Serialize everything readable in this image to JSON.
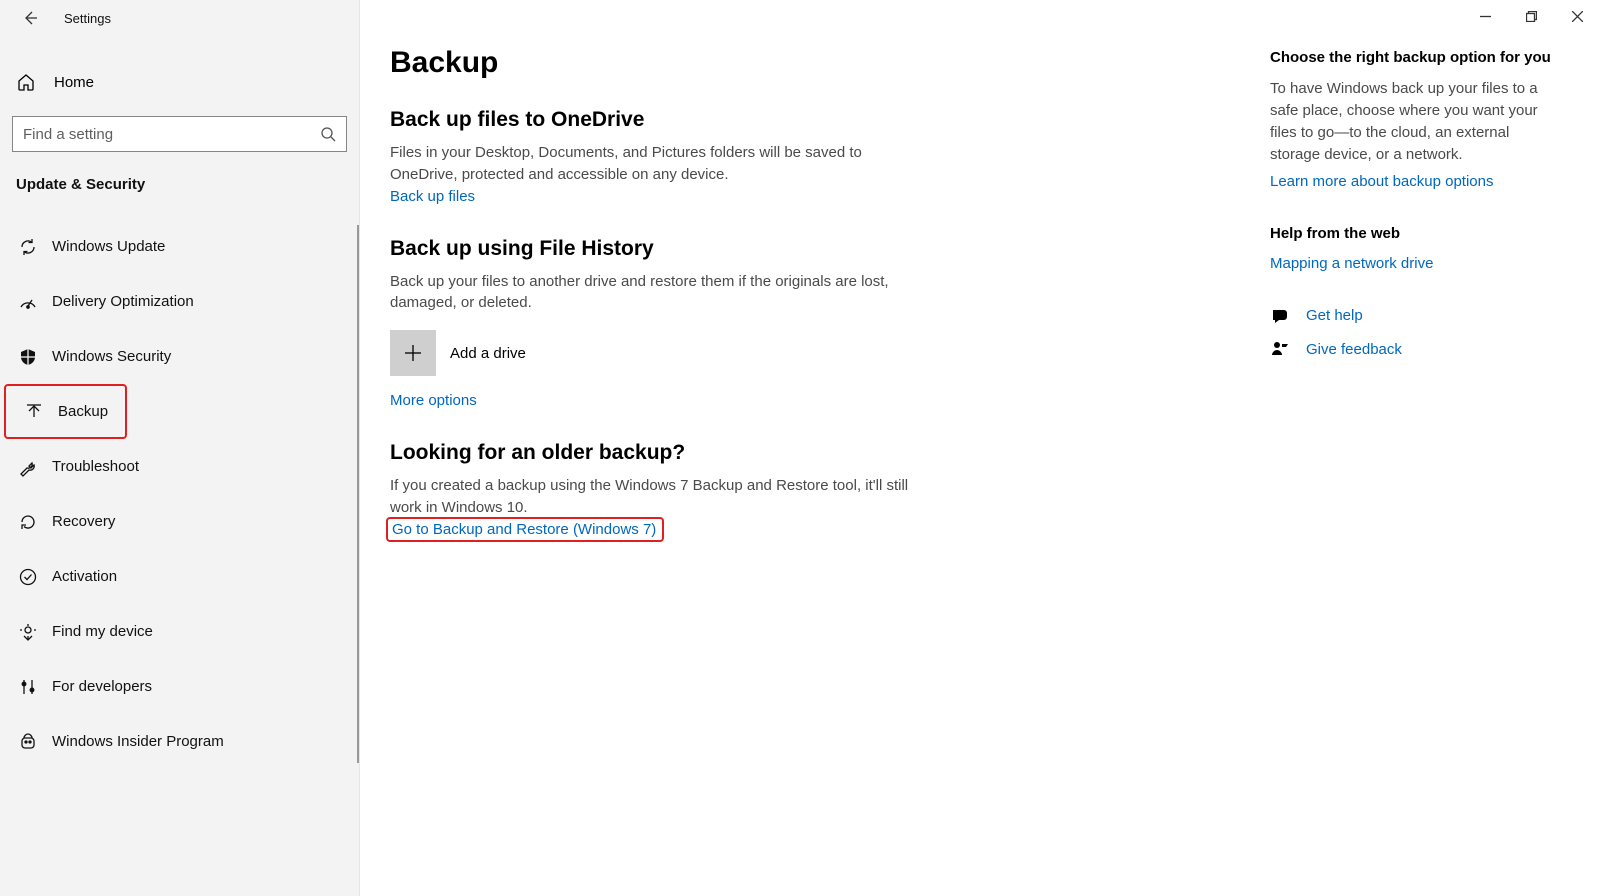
{
  "window": {
    "title": "Settings"
  },
  "sidebar": {
    "home_label": "Home",
    "search": {
      "placeholder": "Find a setting"
    },
    "category": "Update & Security",
    "items": [
      {
        "label": "Windows Update"
      },
      {
        "label": "Delivery Optimization"
      },
      {
        "label": "Windows Security"
      },
      {
        "label": "Backup"
      },
      {
        "label": "Troubleshoot"
      },
      {
        "label": "Recovery"
      },
      {
        "label": "Activation"
      },
      {
        "label": "Find my device"
      },
      {
        "label": "For developers"
      },
      {
        "label": "Windows Insider Program"
      }
    ]
  },
  "page": {
    "title": "Backup",
    "sections": {
      "onedrive": {
        "heading": "Back up files to OneDrive",
        "desc": "Files in your Desktop, Documents, and Pictures folders will be saved to OneDrive, protected and accessible on any device.",
        "link": "Back up files"
      },
      "filehistory": {
        "heading": "Back up using File History",
        "desc": "Back up your files to another drive and restore them if the originals are lost, damaged, or deleted.",
        "add_drive": "Add a drive",
        "more_options": "More options"
      },
      "older": {
        "heading": "Looking for an older backup?",
        "desc": "If you created a backup using the Windows 7 Backup and Restore tool, it'll still work in Windows 10.",
        "link": "Go to Backup and Restore (Windows 7)"
      }
    }
  },
  "right": {
    "choose": {
      "heading": "Choose the right backup option for you",
      "desc": "To have Windows back up your files to a safe place, choose where you want your files to go—to the cloud, an external storage device, or a network.",
      "link": "Learn more about backup options"
    },
    "help_heading": "Help from the web",
    "help_links": {
      "mapping": "Mapping a network drive"
    },
    "get_help": "Get help",
    "feedback": "Give feedback"
  }
}
